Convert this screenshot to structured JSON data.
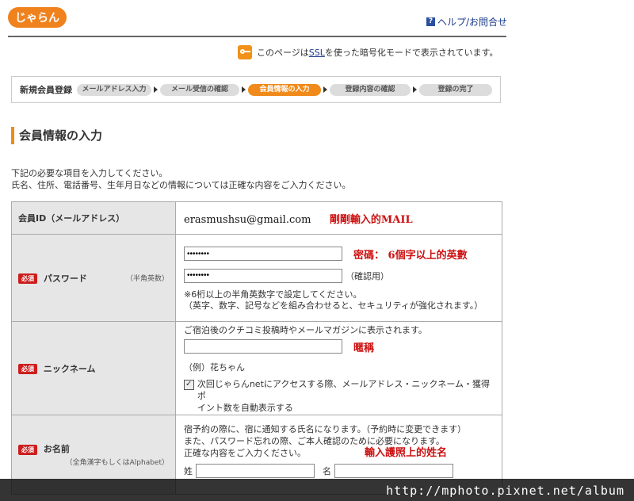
{
  "header": {
    "logo_text": "じゃらん",
    "help_icon": "?",
    "help_label": "ヘルプ/お問合せ"
  },
  "ssl": {
    "icon": "key-icon",
    "prefix": "このページは",
    "link": "SSL",
    "suffix": "を使った暗号化モードで表示されています。"
  },
  "steps": {
    "title": "新規会員登録",
    "items": [
      "メールアドレス入力",
      "メール受信の確認",
      "会員情報の入力",
      "登録内容の確認",
      "登録の完了"
    ],
    "active_index": 2
  },
  "section": {
    "title": "会員情報の入力",
    "intro_line1": "下記の必要な項目を入力してください。",
    "intro_line2": "氏名、住所、電話番号、生年月日などの情報については正確な内容をご入力ください。"
  },
  "form": {
    "required_badge": "必須",
    "member_id": {
      "label": "会員ID（メールアドレス）",
      "value": "erasmushsu@gmail.com",
      "note": "剛剛輸入的MAIL"
    },
    "password": {
      "label": "パスワード",
      "sub": "（半角英数）",
      "value": "••••••••",
      "confirm_value": "••••••••",
      "confirm_label": "（確認用）",
      "note": "密碼：  6個字以上的英數",
      "hint1": "※6桁以上の半角英数字で設定してください。",
      "hint2": "（英字、数字、記号などを組み合わせると、セキュリティが強化されます。）"
    },
    "nickname": {
      "label": "ニックネーム",
      "desc": "ご宿泊後のクチコミ投稿時やメールマガジンに表示されます。",
      "value": "",
      "note": "暱稱",
      "example": "（例）花ちゃん",
      "checkbox_line1": "次回じゃらんnetにアクセスする際、メールアドレス・ニックネーム・獲得ポ",
      "checkbox_line2": "イント数を自動表示する",
      "checked": true
    },
    "name": {
      "label": "お名前",
      "sub": "（全角漢字もしくはAlphabet）",
      "desc1": "宿予約の際に、宿に通知する氏名になります。（予約時に変更できます）",
      "desc2": "また、パスワード忘れの際、ご本人確認のために必要になります。",
      "desc3": "正確な内容をご入力ください。",
      "note": "輸入護照上的姓名",
      "last_label": "姓",
      "first_label": "名"
    }
  },
  "watermark": "http://mphoto.pixnet.net/album",
  "colors": {
    "accent": "#f08a1a",
    "required": "#cc1e1e",
    "note_red": "#cc1111",
    "link": "#1a3a8a"
  }
}
